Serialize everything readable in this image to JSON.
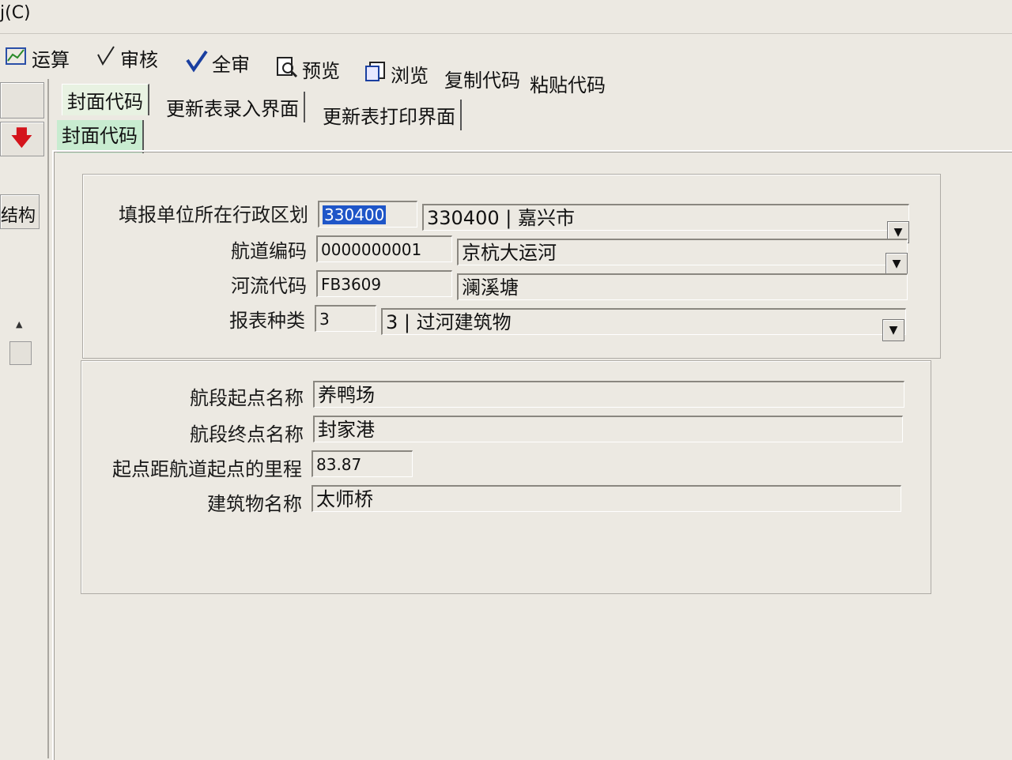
{
  "menu": {
    "fragment": "j(C)"
  },
  "toolbar": {
    "items": [
      {
        "icon": "calculate-icon",
        "label": "运算"
      },
      {
        "icon": "review-check-icon",
        "label": "审核"
      },
      {
        "icon": "full-review-check-icon",
        "label": "全审"
      },
      {
        "icon": "preview-magnifier-icon",
        "label": "预览"
      },
      {
        "icon": "browse-icon",
        "label": "浏览"
      },
      {
        "icon": "",
        "label": "复制代码"
      },
      {
        "icon": "",
        "label": "粘贴代码"
      }
    ]
  },
  "left_panel": {
    "struct_label": "结构",
    "arrow_icon": "down-arrow-icon",
    "arrow_color": "#d4141c"
  },
  "tabs": {
    "top_row": [
      "封面代码",
      "更新表录入界面",
      "更新表打印界面"
    ],
    "sub_row": [
      "封面代码"
    ]
  },
  "form_top": {
    "region": {
      "label": "填报单位所在行政区划",
      "code": "330400",
      "display": "330400 | 嘉兴市"
    },
    "channel": {
      "label": "航道编码",
      "code": "0000000001",
      "display": "京杭大运河"
    },
    "river": {
      "label": "河流代码",
      "code": "FB3609",
      "display": "澜溪塘"
    },
    "report_type": {
      "label": "报表种类",
      "code": "3",
      "display": "3 | 过河建筑物"
    }
  },
  "form_bottom": {
    "start_name": {
      "label": "航段起点名称",
      "value": "养鸭场"
    },
    "end_name": {
      "label": "航段终点名称",
      "value": "封家港"
    },
    "mileage": {
      "label": "起点距航道起点的里程",
      "value": "83.87"
    },
    "building_name": {
      "label": "建筑物名称",
      "value": "太师桥"
    }
  },
  "colors": {
    "selection": "#1f56c8",
    "active_tab": "#c8ecd0",
    "background": "#ece9e2"
  }
}
